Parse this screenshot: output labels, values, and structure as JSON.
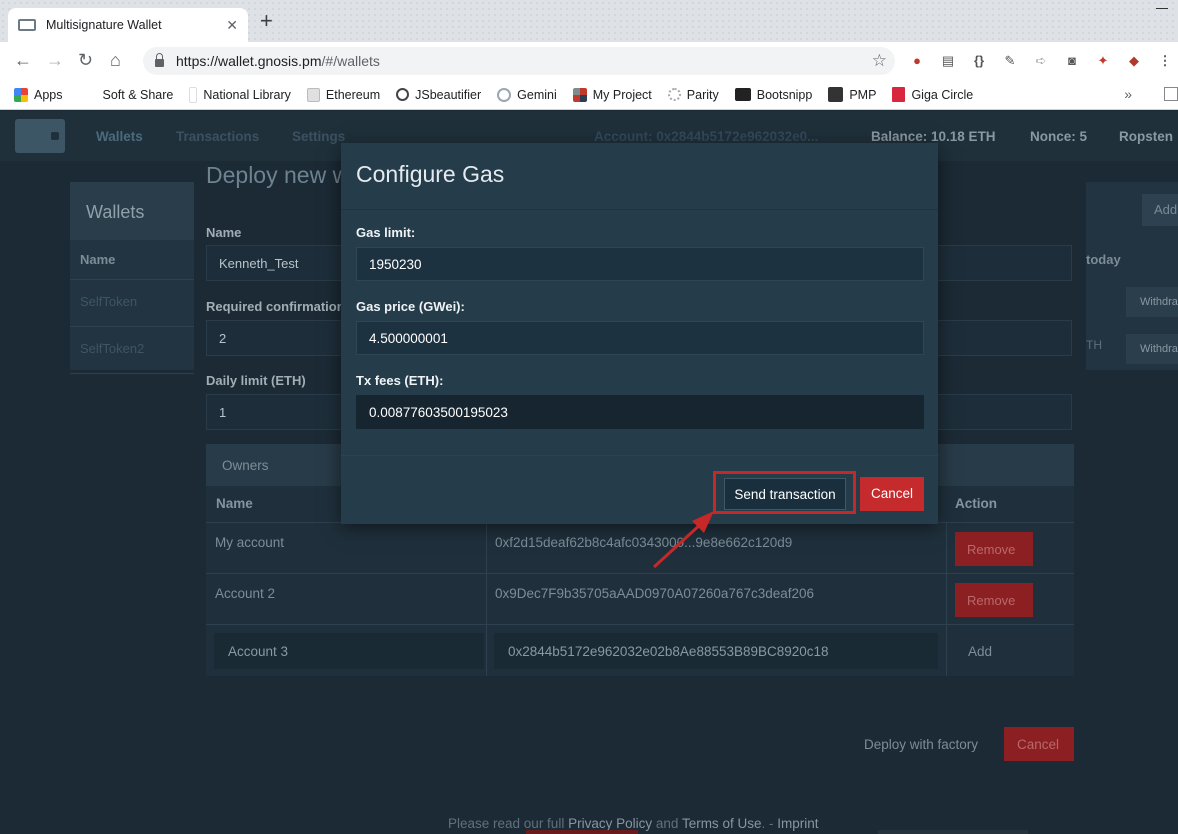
{
  "browser": {
    "tab_title": "Multisignature Wallet",
    "url_host": "https://wallet.gnosis.pm",
    "url_path": "/#/wallets",
    "bookmarks": [
      {
        "label": "Apps",
        "color": "#ea4335"
      },
      {
        "label": "Soft & Share",
        "color": "#ffffff"
      },
      {
        "label": "National Library",
        "color": "#ffffff"
      },
      {
        "label": "Ethereum",
        "color": "#cfcfcf"
      },
      {
        "label": "JSbeautifier",
        "color": "#444444"
      },
      {
        "label": "Gemini",
        "color": "#9aa7b0"
      },
      {
        "label": "My Project",
        "color": "#c0392b"
      },
      {
        "label": "Parity",
        "color": "#bbbbbb"
      },
      {
        "label": "Bootsnipp",
        "color": "#222222"
      },
      {
        "label": "PMP",
        "color": "#333333"
      },
      {
        "label": "Giga Circle",
        "color": "#d7263d"
      }
    ]
  },
  "app": {
    "nav": {
      "wallets": "Wallets",
      "transactions": "Transactions",
      "settings": "Settings",
      "account": "Account: 0x2844b5172e962032e0...",
      "balance": "Balance: 10.18 ETH",
      "nonce": "Nonce: 5",
      "network": "Ropsten"
    },
    "wallets_panel": {
      "title": "Wallets",
      "col_name": "Name",
      "rows": [
        "SelfToken",
        "SelfToken2"
      ]
    },
    "right_panel": {
      "add": "Add",
      "today": "today",
      "withdraw": "Withdraw",
      "eth_fragment": "TH"
    },
    "deploy": {
      "title": "Deploy new wallet",
      "name_label": "Name",
      "name_value": "Kenneth_Test",
      "confirmations_label": "Required confirmations",
      "confirmations_value": "2",
      "daily_limit_label": "Daily limit (ETH)",
      "daily_limit_value": "1",
      "owners_title": "Owners",
      "col_name": "Name",
      "col_action": "Action",
      "owners": [
        {
          "name": "My account",
          "address": "0xf2d15deaf62b8c4afc0343000...9e8e662c120d9",
          "action": "Remove"
        },
        {
          "name": "Account 2",
          "address": "0x9Dec7F9b35705aAAD0970A07260a767c3deaf206",
          "action": "Remove"
        }
      ],
      "new_owner": {
        "name": "Account 3",
        "address": "0x2844b5172e962032e02b8Ae88553B89BC8920c18",
        "action": "Add"
      },
      "deploy_factory": "Deploy with factory",
      "cancel": "Cancel"
    },
    "footer": {
      "pre": "Please read our full",
      "privacy": "Privacy Policy",
      "and": "and",
      "terms": "Terms of Use",
      "sep": ". -",
      "imprint": "Imprint"
    }
  },
  "modal": {
    "title": "Configure Gas",
    "gas_limit_label": "Gas limit:",
    "gas_limit_value": "1950230",
    "gas_price_label": "Gas price (GWei):",
    "gas_price_value": "4.500000001",
    "tx_fees_label": "Tx fees (ETH):",
    "tx_fees_value": "0.00877603500195023",
    "send_button": "Send transaction",
    "cancel_button": "Cancel"
  },
  "annotation": {
    "highlight_color": "#c62828"
  }
}
